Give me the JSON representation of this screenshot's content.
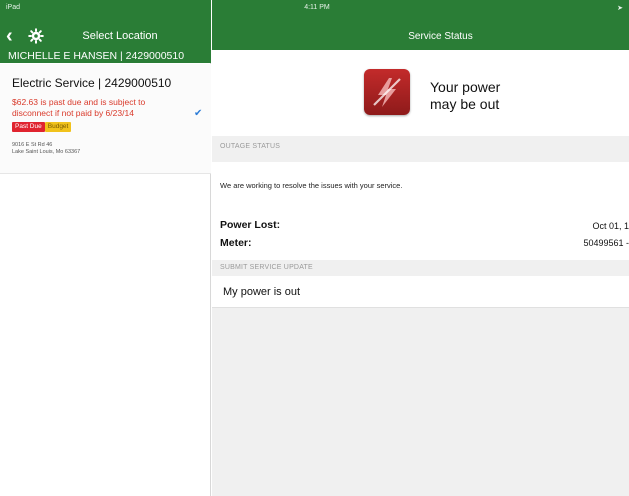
{
  "status_bar": {
    "device": "iPad",
    "time": "4:11 PM"
  },
  "left_pane": {
    "nav_title": "Select Location",
    "account_bar": "MICHELLE E HANSEN | 2429000510",
    "service": {
      "title": "Electric Service | 2429000510",
      "past_due_message": "$62.63 is past due and is subject to disconnect if not paid by 6/23/14",
      "badges": [
        "Past Due",
        "Budget"
      ],
      "address_line1": "9016 E St Rd 46",
      "address_line2": "Lake Saint Louis, Mo 63367"
    }
  },
  "right_pane": {
    "title": "Service Status",
    "hero_line1": "Your power",
    "hero_line2": "may be out",
    "outage_section_label": "OUTAGE STATUS",
    "outage_message": "We are working to resolve the issues with your service.",
    "power_lost_label": "Power Lost:",
    "power_lost_value": "Oct 01, 1",
    "meter_label": "Meter:",
    "meter_value": "50499561 -",
    "update_section_label": "SUBMIT SERVICE UPDATE",
    "update_option": "My power is out"
  },
  "colors": {
    "header_green": "#2a7d36",
    "past_due_red": "#d93a2b",
    "check_blue": "#2e7dd7"
  }
}
